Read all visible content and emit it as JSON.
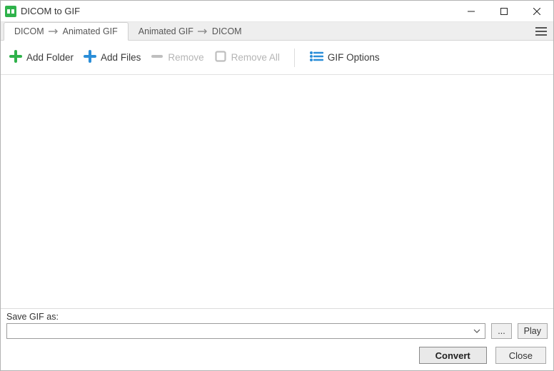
{
  "window": {
    "title": "DICOM to GIF"
  },
  "tabs": {
    "tab1_a": "DICOM",
    "tab1_b": "Animated GIF",
    "tab2_a": "Animated GIF",
    "tab2_b": "DICOM"
  },
  "toolbar": {
    "add_folder": "Add Folder",
    "add_files": "Add Files",
    "remove": "Remove",
    "remove_all": "Remove All",
    "gif_options": "GIF Options"
  },
  "save": {
    "label": "Save GIF as:",
    "value": "",
    "browse": "...",
    "play": "Play"
  },
  "footer": {
    "convert": "Convert",
    "close": "Close"
  }
}
